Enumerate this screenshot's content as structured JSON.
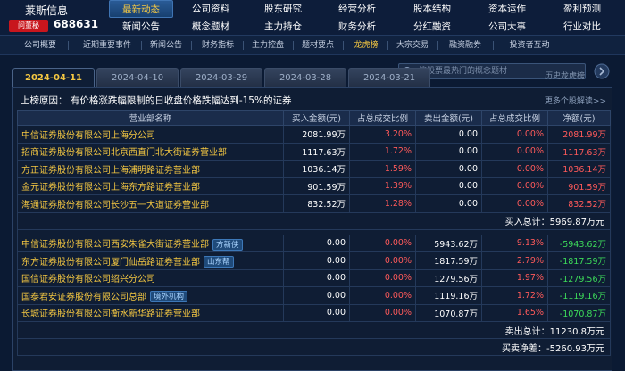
{
  "header": {
    "brand_name": "莱斯信息",
    "qa_badge": "问董秘",
    "stock_code": "688631",
    "nav_row1": [
      "最新动态",
      "公司资料",
      "股东研究",
      "经营分析",
      "股本结构",
      "资本运作",
      "盈利预测"
    ],
    "nav_row2": [
      "新闻公告",
      "概念题材",
      "主力持仓",
      "财务分析",
      "分红融资",
      "公司大事",
      "行业对比"
    ]
  },
  "subnav": [
    "公司概要",
    "近期重要事件",
    "新闻公告",
    "财务指标",
    "主力控盘",
    "题材要点",
    "龙虎榜",
    "大宗交易",
    "融资融券",
    "投资者互动"
  ],
  "tabs": [
    "2024-04-11",
    "2024-04-10",
    "2024-03-29",
    "2024-03-28",
    "2024-03-21"
  ],
  "search": {
    "placeholder": "搜股票最热门的概念题材"
  },
  "history_label": "历史龙虎榜",
  "reason": "上榜原因：  有价格涨跌幅限制的日收盘价格跌幅达到-15%的证券",
  "more_link": "更多个股解读>>",
  "columns": [
    "营业部名称",
    "买入金额(元)",
    "占总成交比例",
    "卖出金额(元)",
    "占总成交比例",
    "净额(元)"
  ],
  "buy_rows": [
    {
      "name": "中信证券股份有限公司上海分公司",
      "buy": "2081.99万",
      "buy_ratio": "3.20%",
      "sell": "0.00",
      "sell_ratio": "0.00%",
      "net": "2081.99万"
    },
    {
      "name": "招商证券股份有限公司北京西直门北大街证券营业部",
      "buy": "1117.63万",
      "buy_ratio": "1.72%",
      "sell": "0.00",
      "sell_ratio": "0.00%",
      "net": "1117.63万"
    },
    {
      "name": "方正证券股份有限公司上海浦明路证券营业部",
      "buy": "1036.14万",
      "buy_ratio": "1.59%",
      "sell": "0.00",
      "sell_ratio": "0.00%",
      "net": "1036.14万"
    },
    {
      "name": "金元证券股份有限公司上海东方路证券营业部",
      "buy": "901.59万",
      "buy_ratio": "1.39%",
      "sell": "0.00",
      "sell_ratio": "0.00%",
      "net": "901.59万"
    },
    {
      "name": "海通证券股份有限公司长沙五一大道证券营业部",
      "buy": "832.52万",
      "buy_ratio": "1.28%",
      "sell": "0.00",
      "sell_ratio": "0.00%",
      "net": "832.52万"
    }
  ],
  "buy_total": {
    "label": "买入总计：",
    "value": "5969.87万元"
  },
  "sell_rows": [
    {
      "name": "中信证券股份有限公司西安朱雀大街证券营业部",
      "badge": "方新侠",
      "buy": "0.00",
      "buy_ratio": "0.00%",
      "sell": "5943.62万",
      "sell_ratio": "9.13%",
      "net": "-5943.62万"
    },
    {
      "name": "东方证券股份有限公司厦门仙岳路证券营业部",
      "badge": "山东帮",
      "buy": "0.00",
      "buy_ratio": "0.00%",
      "sell": "1817.59万",
      "sell_ratio": "2.79%",
      "net": "-1817.59万"
    },
    {
      "name": "国信证券股份有限公司绍兴分公司",
      "badge": "",
      "buy": "0.00",
      "buy_ratio": "0.00%",
      "sell": "1279.56万",
      "sell_ratio": "1.97%",
      "net": "-1279.56万"
    },
    {
      "name": "国泰君安证券股份有限公司总部",
      "badge": "境外机构",
      "buy": "0.00",
      "buy_ratio": "0.00%",
      "sell": "1119.16万",
      "sell_ratio": "1.72%",
      "net": "-1119.16万"
    },
    {
      "name": "长城证券股份有限公司衡水新华路证券营业部",
      "badge": "",
      "buy": "0.00",
      "buy_ratio": "0.00%",
      "sell": "1070.87万",
      "sell_ratio": "1.65%",
      "net": "-1070.87万"
    }
  ],
  "sell_total": {
    "label": "卖出总计：",
    "value": "11230.8万元"
  },
  "net_total": {
    "label": "买卖净差：",
    "value": "-5260.93万元"
  },
  "colors": {
    "accent": "#f5c842",
    "positive": "#ff5a5a",
    "negative": "#3ddc5a",
    "background": "#0b1a33"
  }
}
